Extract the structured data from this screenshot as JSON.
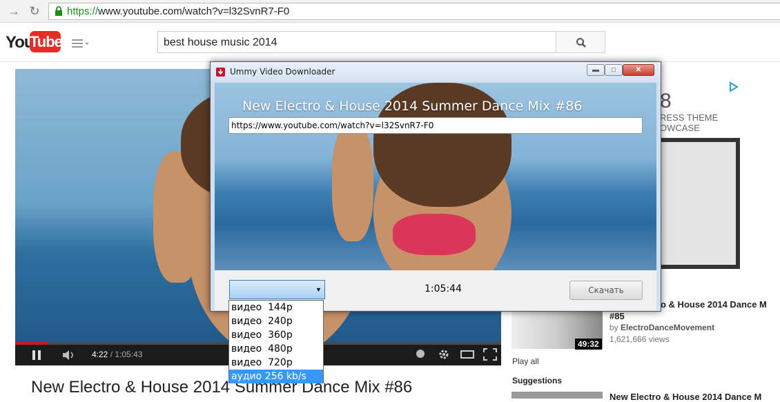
{
  "browser": {
    "url_scheme": "https://",
    "url_rest": "www.youtube.com/watch?v=l32SvnR7-F0"
  },
  "youtube": {
    "logo_you": "You",
    "logo_tube": "Tube",
    "search_value": "best house music 2014",
    "player_time_current": "4:22",
    "player_time_total": "1:05:43",
    "video_title": "New Electro & House 2014 Summer Dance Mix #86",
    "ad_lines": [
      "8",
      "RESS THEME",
      "OWCASE"
    ],
    "related": {
      "title": "o & House 2014 Dance M",
      "by_prefix": "by ",
      "channel": "ElectroDanceMovement",
      "views": "1,621,666 views",
      "number": "#85",
      "duration": "49:32",
      "play_all": "Play all",
      "suggestions": "Suggestions",
      "next_title": "New Electro & House 2014 Dance M"
    }
  },
  "ummy": {
    "window_title": "Ummy Video Downloader",
    "banner_title": "New Electro & House 2014 Summer Dance Mix #86",
    "url_value": "https://www.youtube.com/watch?v=l32SvnR7-F0",
    "duration": "1:05:44",
    "download_label": "Скачать",
    "formats": [
      "видео  144p",
      "видео  240p",
      "видео  360p",
      "видео  480p",
      "видео  720p",
      "аудио 256 kb/s"
    ],
    "selected_format_index": 5
  },
  "colors": {
    "youtube_red": "#e52d27",
    "selection_blue": "#3399ff",
    "progress_red": "#cc181e"
  }
}
